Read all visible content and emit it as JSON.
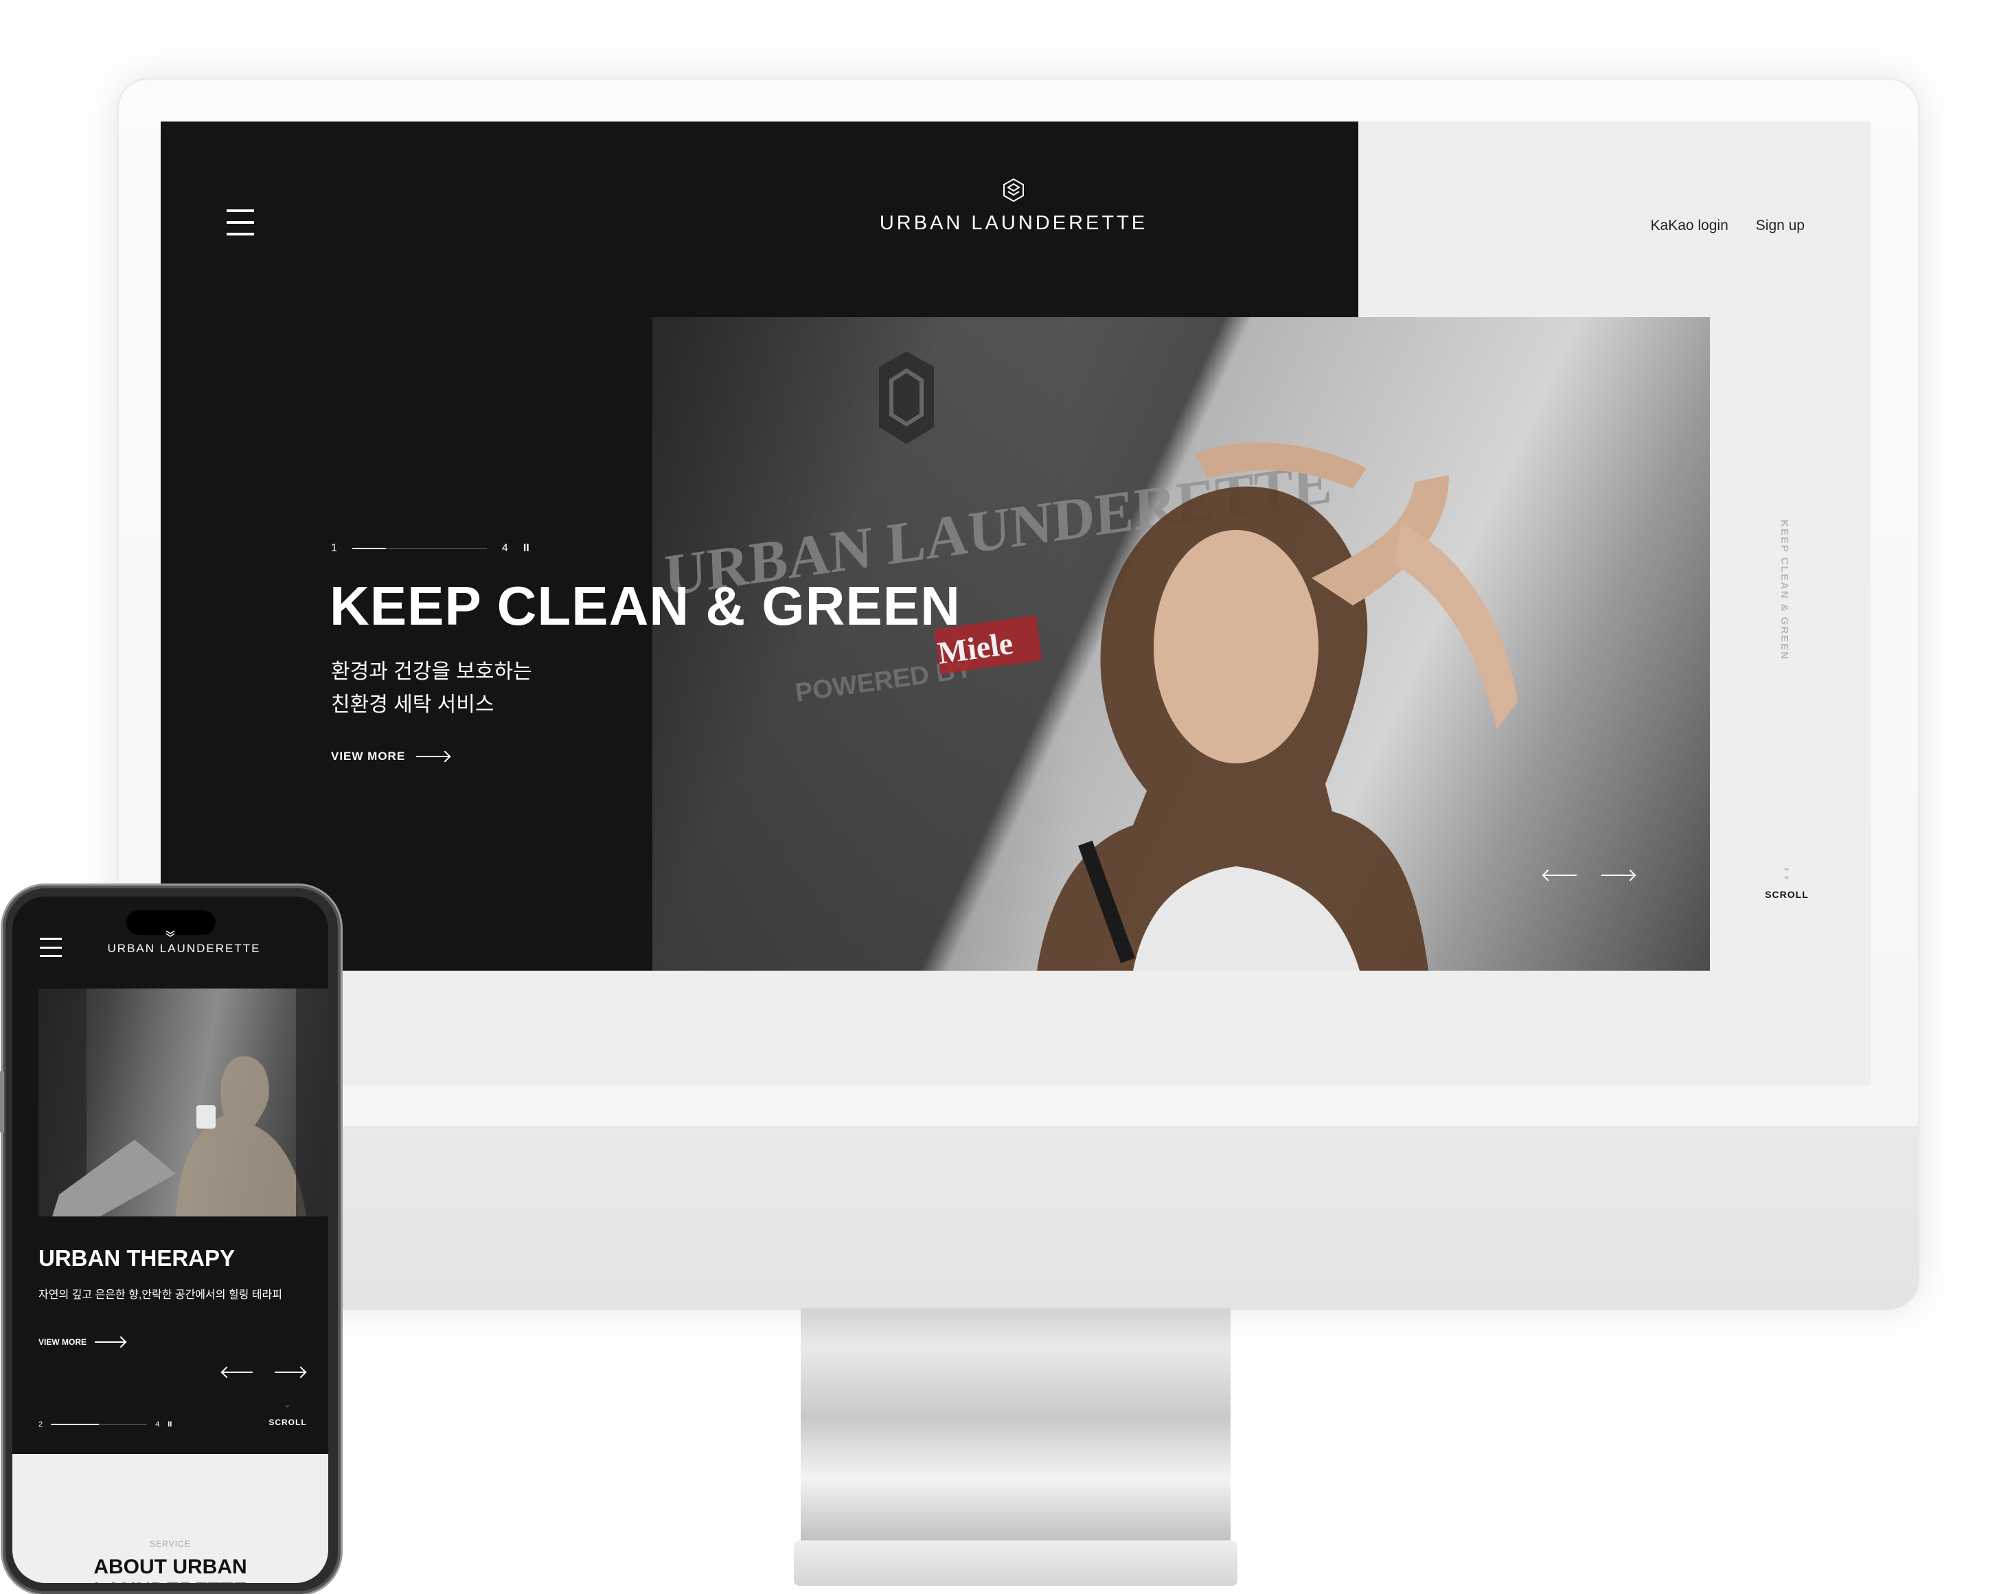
{
  "desktop": {
    "brand": "URBAN LAUNDERETTE",
    "top_links": {
      "kakao_login": "KaKao login",
      "sign_up": "Sign up"
    },
    "hero": {
      "pager": {
        "current": "1",
        "total": "4",
        "pause": "II",
        "progress": 0.25
      },
      "title": "KEEP CLEAN & GREEN",
      "subtitle": "환경과 건강을 보호하는\n친환경 세탁 서비스",
      "view_more": "VIEW MORE",
      "photo_sign_text": "URBAN LAUNDERETTE",
      "photo_sign_sub": "POWERED BY",
      "photo_sign_brand": "Miele"
    },
    "vertical_label": "KEEP CLEAN & GREEN",
    "scroll": "SCROLL"
  },
  "mobile": {
    "brand": "URBAN LAUNDERETTE",
    "hero": {
      "title": "URBAN THERAPY",
      "subtitle": "자연의 깊고 은은한 향,안락한 공간에서의 힐링 테라피",
      "view_more": "VIEW MORE",
      "pager": {
        "current": "2",
        "total": "4",
        "pause": "II",
        "progress": 0.5
      }
    },
    "scroll": "SCROLL",
    "section": {
      "eyebrow": "SERVICE",
      "heading": "ABOUT URBAN\nLAUNDERETTE"
    }
  },
  "colors": {
    "dark": "#141414",
    "light_bg": "#eeeeee",
    "accent_red": "#a8262c"
  }
}
